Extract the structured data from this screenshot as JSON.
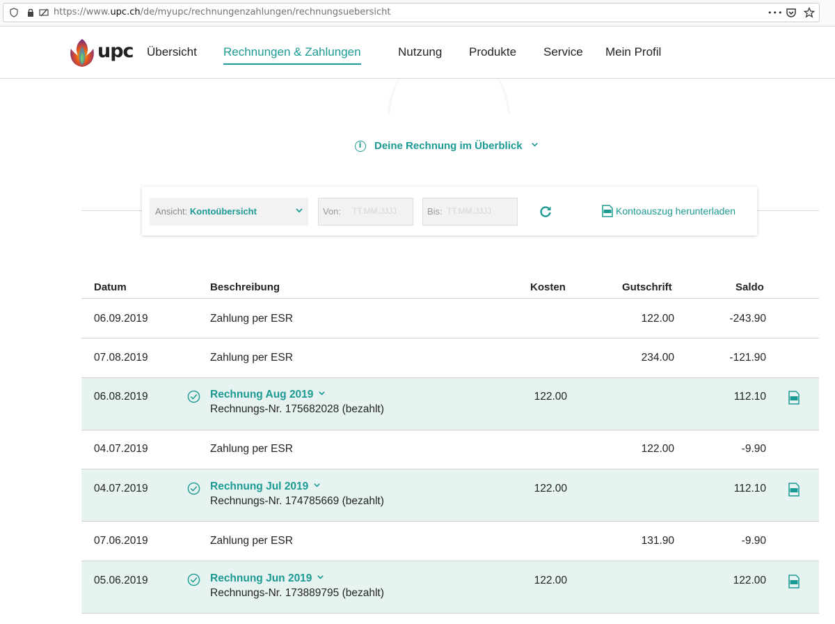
{
  "browser": {
    "url_prefix": "https://www.",
    "url_domain": "upc.ch",
    "url_path": "/de/myupc/rechnungenzahlungen/rechnungsuebersicht",
    "menu_glyph": "•••"
  },
  "header": {
    "logo_text": "upc",
    "nav": [
      "Übersicht",
      "Rechnungen & Zahlungen",
      "Nutzung",
      "Produkte",
      "Service",
      "Mein Profil"
    ],
    "active_nav": "Rechnungen & Zahlungen"
  },
  "overview_link": "Deine Rechnung im Überblick",
  "filters": {
    "view_label": "Ansicht:",
    "view_value": "Kontoübersicht",
    "from_label": "Von:",
    "from_placeholder": "TT.MM.JJJJ",
    "to_label": "Bis:",
    "to_placeholder": "TT.MM.JJJJ",
    "download_label": "Kontoauszug herunterladen"
  },
  "table": {
    "headers": {
      "date": "Datum",
      "description": "Beschreibung",
      "cost": "Kosten",
      "credit": "Gutschrift",
      "balance": "Saldo"
    },
    "rows": [
      {
        "date": "06.09.2019",
        "type": "payment",
        "description": "Zahlung per ESR",
        "cost": "",
        "credit": "122.00",
        "balance": "-243.90"
      },
      {
        "date": "07.08.2019",
        "type": "payment",
        "description": "Zahlung per ESR",
        "cost": "",
        "credit": "234.00",
        "balance": "-121.90"
      },
      {
        "date": "06.08.2019",
        "type": "invoice",
        "title": "Rechnung Aug 2019",
        "description": "Rechnungs-Nr. 175682028 (bezahlt)",
        "cost": "122.00",
        "credit": "",
        "balance": "112.10"
      },
      {
        "date": "04.07.2019",
        "type": "payment",
        "description": "Zahlung per ESR",
        "cost": "",
        "credit": "122.00",
        "balance": "-9.90"
      },
      {
        "date": "04.07.2019",
        "type": "invoice",
        "title": "Rechnung Jul 2019",
        "description": "Rechnungs-Nr. 174785669 (bezahlt)",
        "cost": "122.00",
        "credit": "",
        "balance": "112.10"
      },
      {
        "date": "07.06.2019",
        "type": "payment",
        "description": "Zahlung per ESR",
        "cost": "",
        "credit": "131.90",
        "balance": "-9.90"
      },
      {
        "date": "05.06.2019",
        "type": "invoice",
        "title": "Rechnung Jun 2019",
        "description": "Rechnungs-Nr. 173889795 (bezahlt)",
        "cost": "122.00",
        "credit": "",
        "balance": "122.00"
      }
    ]
  },
  "colors": {
    "accent": "#1a9a92",
    "invoice_row_bg": "#e7f3f0"
  }
}
